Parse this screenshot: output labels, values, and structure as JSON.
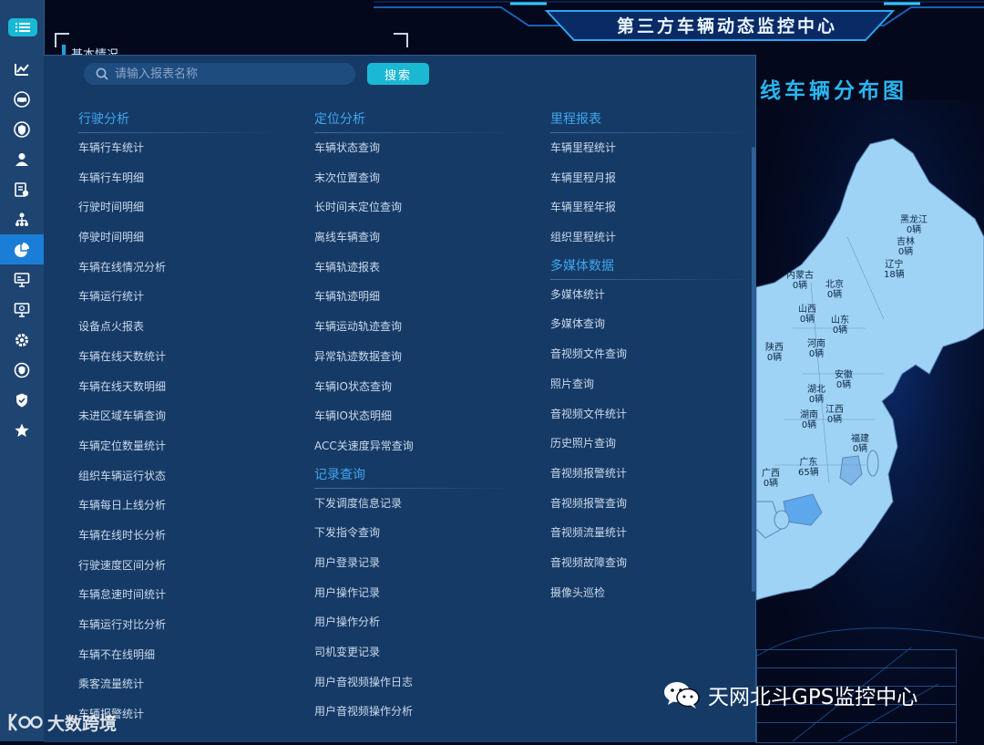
{
  "rail": {
    "items": [
      {
        "icon": "trend-chart-icon"
      },
      {
        "icon": "car-icon"
      },
      {
        "icon": "shield-user-icon"
      },
      {
        "icon": "person-icon"
      },
      {
        "icon": "report-settings-icon"
      },
      {
        "icon": "org-tree-icon"
      },
      {
        "icon": "pie-chart-icon",
        "active": true
      },
      {
        "icon": "monitor-icon"
      },
      {
        "icon": "screen-search-icon"
      },
      {
        "icon": "gear-icon"
      },
      {
        "icon": "shield-refresh-icon"
      },
      {
        "icon": "shield-check-icon"
      },
      {
        "icon": "star-icon"
      }
    ]
  },
  "dashboard": {
    "title": "第三方车辆动态监控中心",
    "section_label": "基本情况",
    "map_title": "线车辆分布图",
    "map_labels": [
      {
        "text": "黑龙江\n0辆"
      },
      {
        "text": "吉林\n0辆"
      },
      {
        "text": "辽宁\n18辆"
      },
      {
        "text": "内蒙古\n0辆"
      },
      {
        "text": "北京\n0辆"
      },
      {
        "text": "山西\n0辆"
      },
      {
        "text": "山东\n0辆"
      },
      {
        "text": "陕西\n0辆"
      },
      {
        "text": "河南\n0辆"
      },
      {
        "text": "安徽\n0辆"
      },
      {
        "text": "湖北\n0辆"
      },
      {
        "text": "湖南\n0辆"
      },
      {
        "text": "江西\n0辆"
      },
      {
        "text": "福建\n0辆"
      },
      {
        "text": "广西\n0辆"
      },
      {
        "text": "广东\n65辆"
      }
    ]
  },
  "panel": {
    "search": {
      "placeholder": "请输入报表名称",
      "value": "",
      "button_label": "搜索"
    },
    "columns": [
      {
        "groups": [
          {
            "title": "行驶分析",
            "items": [
              "车辆行车统计",
              "车辆行车明细",
              "行驶时间明细",
              "停驶时间明细",
              "车辆在线情况分析",
              "车辆运行统计",
              "设备点火报表",
              "车辆在线天数统计",
              "车辆在线天数明细",
              "未进区域车辆查询",
              "车辆定位数量统计",
              "组织车辆运行状态",
              "车辆每日上线分析",
              "车辆在线时长分析",
              "行驶速度区间分析",
              "车辆怠速时间统计",
              "车辆运行对比分析",
              "车辆不在线明细",
              "乘客流量统计",
              "车辆报警统计"
            ]
          }
        ]
      },
      {
        "groups": [
          {
            "title": "定位分析",
            "items": [
              "车辆状态查询",
              "末次位置查询",
              "长时间未定位查询",
              "离线车辆查询",
              "车辆轨迹报表",
              "车辆轨迹明细",
              "车辆运动轨迹查询",
              "异常轨迹数据查询",
              "车辆IO状态查询",
              "车辆IO状态明细",
              "ACC关速度异常查询"
            ]
          },
          {
            "title": "记录查询",
            "items": [
              "下发调度信息记录",
              "下发指令查询",
              "用户登录记录",
              "用户操作记录",
              "用户操作分析",
              "司机变更记录",
              "用户音视频操作日志",
              "用户音视频操作分析"
            ]
          }
        ]
      },
      {
        "groups": [
          {
            "title": "里程报表",
            "items": [
              "车辆里程统计",
              "车辆里程月报",
              "车辆里程年报",
              "组织里程统计"
            ]
          },
          {
            "title": "多媒体数据",
            "items": [
              "多媒体统计",
              "多媒体查询",
              "音视频文件查询",
              "照片查询",
              "音视频文件统计",
              "历史照片查询",
              "音视频报警统计",
              "音视频报警查询",
              "音视频流量统计",
              "音视频故障查询",
              "摄像头巡检"
            ]
          }
        ]
      }
    ]
  },
  "watermark": {
    "right_text": "天网北斗GPS监控中心",
    "left_text": "大数跨境"
  },
  "colors": {
    "rail_bg": "#1e4471",
    "active_rail": "#1b7ed6",
    "panel_bg": "#163a66",
    "group_title": "#3ea6ec",
    "menu_text": "#cad9ea",
    "search_button": "#1bb8d4",
    "map_fill": "#9fd3f5",
    "map_title": "#29b6ef"
  }
}
